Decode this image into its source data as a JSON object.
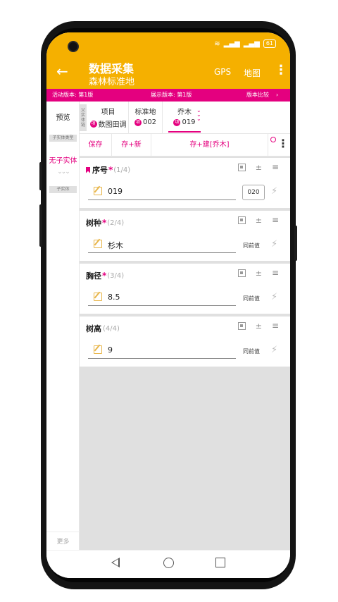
{
  "app": {
    "title": "数据采集",
    "subtitle": "森林标准地",
    "gps_label": "GPS",
    "map_label": "地图",
    "back_icon": "back-arrow-icon",
    "more_icon": "more-vert-icon"
  },
  "status_bar": {
    "battery": "61"
  },
  "version_bar": {
    "active": "活动版本: 第1版",
    "display": "展示版本: 第1版",
    "compare": "版本比较",
    "compare_icon": "chevron-right-icon"
  },
  "sidebar": {
    "preview": "预览",
    "child_type_label": "子实体类型",
    "no_child": "无子实体",
    "child_label": "子实体",
    "more": "更多"
  },
  "entities": {
    "parent_label": "父实体链",
    "tabs": [
      {
        "name": "项目",
        "badge": "项",
        "value": "数图田调"
      },
      {
        "name": "标准地",
        "badge": "项",
        "value": "002"
      },
      {
        "name": "乔木",
        "badge": "项",
        "value": "019"
      }
    ]
  },
  "actions": {
    "save": "保存",
    "save_new": "存+新",
    "save_create": "存+建[乔木]"
  },
  "fields": [
    {
      "label": "序号",
      "required": "*",
      "count": "(1/4)",
      "value": "019",
      "prev": "020"
    },
    {
      "label": "树种",
      "required": "*",
      "count": "(2/4)",
      "value": "杉木",
      "prev": "同前值"
    },
    {
      "label": "胸径",
      "required": "*",
      "count": "(3/4)",
      "value": "8.5",
      "prev": "同前值"
    },
    {
      "label": "树高",
      "required": "",
      "count": "(4/4)",
      "value": "9",
      "prev": "同前值"
    }
  ],
  "colors": {
    "accent": "#e4007f",
    "appbar": "#f5b000"
  }
}
